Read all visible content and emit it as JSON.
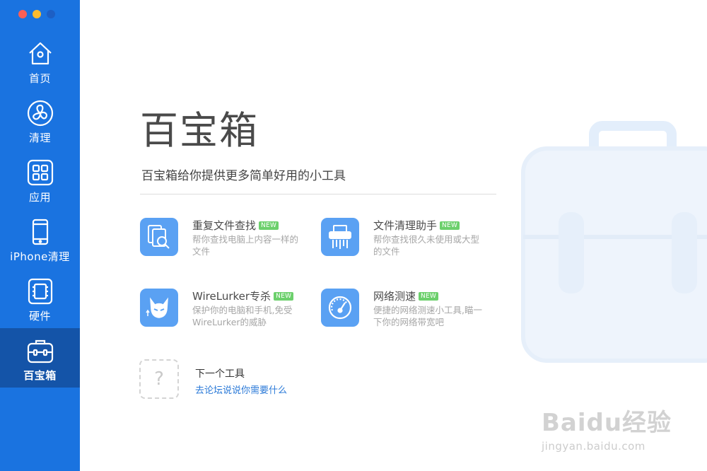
{
  "window": {
    "controls": [
      "close",
      "minimize",
      "zoom"
    ]
  },
  "sidebar": {
    "items": [
      {
        "label": "首页",
        "icon": "house-icon"
      },
      {
        "label": "清理",
        "icon": "fan-icon"
      },
      {
        "label": "应用",
        "icon": "apps-grid-icon"
      },
      {
        "label": "iPhone清理",
        "icon": "phone-icon"
      },
      {
        "label": "硬件",
        "icon": "chip-icon"
      },
      {
        "label": "百宝箱",
        "icon": "toolbox-icon",
        "active": true
      }
    ]
  },
  "main": {
    "title": "百宝箱",
    "subtitle": "百宝箱给你提供更多简单好用的小工具",
    "tools": [
      {
        "name": "重复文件查找",
        "badge": "NEW",
        "desc_lines": [
          "帮你查找电脑上内容一样的",
          "文件"
        ],
        "icon": "duplicate-file-search-icon"
      },
      {
        "name": "文件清理助手",
        "badge": "NEW",
        "desc_lines": [
          "帮你查找很久未使用或大型",
          "的文件"
        ],
        "icon": "shredder-icon"
      },
      {
        "name": "WireLurker专杀",
        "badge": "NEW",
        "desc_lines": [
          "保护你的电脑和手机,免受",
          "WireLurker的威胁"
        ],
        "icon": "devil-cat-icon"
      },
      {
        "name": "网络测速",
        "badge": "NEW",
        "desc_lines": [
          "便捷的网络测速小工具,瞄一",
          "下你的网络带宽吧"
        ],
        "icon": "speedometer-icon"
      }
    ],
    "next_tool": {
      "placeholder_symbol": "?",
      "title": "下一个工具",
      "link": "去论坛说说你需要什么"
    }
  },
  "watermark": {
    "logo_text": "Baidu经验",
    "url": "jingyan.baidu.com"
  },
  "colors": {
    "sidebar": "#1a73e0",
    "sidebar_active": "#1454a8",
    "icon_bg": "#5aa1f3",
    "badge": "#6cd06c",
    "link": "#2b7ad8"
  }
}
